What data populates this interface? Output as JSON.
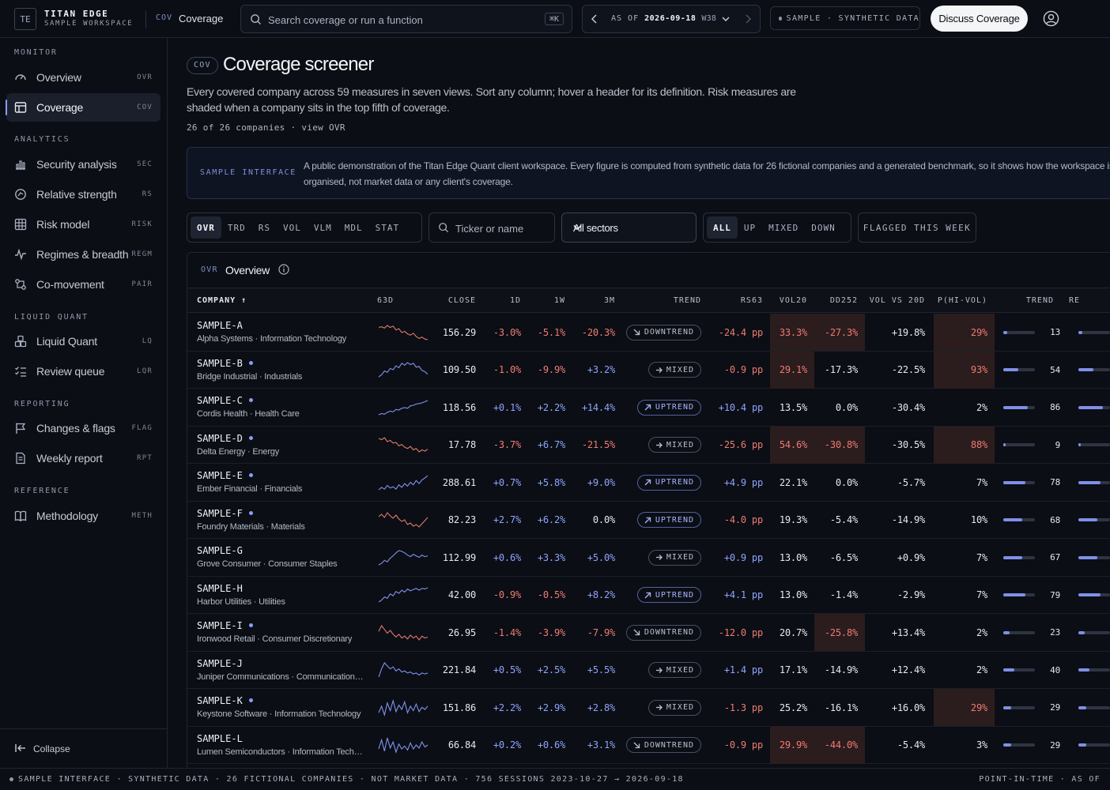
{
  "brand": {
    "logo": "TE",
    "name": "TITAN EDGE",
    "sub": "SAMPLE WORKSPACE"
  },
  "breadcrumb": {
    "code": "COV",
    "label": "Coverage"
  },
  "search": {
    "placeholder": "Search coverage or run a function",
    "shortcut": "⌘K"
  },
  "asof": {
    "label": "AS OF",
    "date": "2026-09-18",
    "week": "W38"
  },
  "sample_badge": "SAMPLE · SYNTHETIC DATA",
  "discuss_label": "Discuss Coverage",
  "sidebar": {
    "sections": [
      {
        "title": "MONITOR",
        "items": [
          {
            "label": "Overview",
            "code": "OVR",
            "icon": "gauge-icon"
          },
          {
            "label": "Coverage",
            "code": "COV",
            "icon": "table-icon",
            "active": true
          }
        ]
      },
      {
        "title": "ANALYTICS",
        "items": [
          {
            "label": "Security analysis",
            "code": "SEC",
            "icon": "bar-chart-icon"
          },
          {
            "label": "Relative strength",
            "code": "RS",
            "icon": "target-icon"
          },
          {
            "label": "Risk model",
            "code": "RISK",
            "icon": "grid-icon"
          },
          {
            "label": "Regimes & breadth",
            "code": "REGM",
            "icon": "activity-icon"
          },
          {
            "label": "Co-movement",
            "code": "PAIR",
            "icon": "link-icon"
          }
        ]
      },
      {
        "title": "LIQUID QUANT",
        "items": [
          {
            "label": "Liquid Quant",
            "code": "LQ",
            "icon": "cubes-icon"
          },
          {
            "label": "Review queue",
            "code": "LQR",
            "icon": "checklist-icon"
          }
        ]
      },
      {
        "title": "REPORTING",
        "items": [
          {
            "label": "Changes & flags",
            "code": "FLAG",
            "icon": "flag-icon"
          },
          {
            "label": "Weekly report",
            "code": "RPT",
            "icon": "document-icon"
          }
        ]
      },
      {
        "title": "REFERENCE",
        "items": [
          {
            "label": "Methodology",
            "code": "METH",
            "icon": "book-icon"
          }
        ]
      }
    ],
    "collapse_label": "Collapse"
  },
  "page": {
    "badge": "COV",
    "title": "Coverage screener",
    "description": "Every covered company across 59 measures in seven views. Sort any column; hover a header for its definition. Risk measures are shaded when a company sits in the top fifth of coverage.",
    "meta": "26 of 26 companies · view OVR"
  },
  "notice": {
    "tag": "SAMPLE INTERFACE",
    "text": "A public demonstration of the Titan Edge Quant client workspace. Every figure is computed from synthetic data for 26 fictional companies and a generated benchmark, so it shows how the workspace is organised, not market data or any client's coverage."
  },
  "view_tabs": [
    "OVR",
    "TRD",
    "RS",
    "VOL",
    "VLM",
    "MDL",
    "STAT"
  ],
  "active_view": "OVR",
  "ticker_filter": {
    "placeholder": "Ticker or name"
  },
  "sector_filter": {
    "selected": "All sectors"
  },
  "trend_filters": [
    "ALL",
    "UP",
    "MIXED",
    "DOWN"
  ],
  "active_trend": "ALL",
  "flagged_label": "FLAGGED THIS WEEK",
  "table": {
    "code": "OVR",
    "title": "Overview",
    "headers": {
      "company": "COMPANY",
      "spark": "63D",
      "close": "CLOSE",
      "d1": "1D",
      "w1": "1W",
      "m3": "3M",
      "trend": "TREND",
      "rs63": "RS63",
      "vol20": "VOL20",
      "dd252": "DD252",
      "volvs": "VOL VS 20D",
      "phivol": "P(HI-VOL)",
      "trendscore": "TREND",
      "re": "RE"
    },
    "rows": [
      {
        "ticker": "SAMPLE-A",
        "flag": false,
        "name": "Alpha Systems · Information Technology",
        "close": "156.29",
        "d1": "-3.0%",
        "w1": "-5.1%",
        "m3": "-20.3%",
        "trend": "DOWNTREND",
        "rs63": "-24.4 pp",
        "vol20": "33.3%",
        "vol20_hl": true,
        "dd252": "-27.3%",
        "dd252_hl": true,
        "volvs": "+19.8%",
        "phivol": "29%",
        "phivol_hl": true,
        "trendscore": "13",
        "spark": [
          5,
          5.2,
          4.8,
          5.6,
          5,
          5.4,
          4.2,
          4.6,
          3.4,
          3.8,
          3,
          2.6,
          3.2,
          2.2,
          1.6,
          2,
          1.4,
          1.2
        ]
      },
      {
        "ticker": "SAMPLE-B",
        "flag": true,
        "name": "Bridge Industrial · Industrials",
        "close": "109.50",
        "d1": "-1.0%",
        "w1": "-9.9%",
        "m3": "+3.2%",
        "trend": "MIXED",
        "rs63": "-0.9 pp",
        "vol20": "29.1%",
        "vol20_hl": true,
        "dd252": "-17.3%",
        "dd252_hl": false,
        "volvs": "-22.5%",
        "phivol": "93%",
        "phivol_hl": true,
        "trendscore": "54",
        "spark": [
          1.6,
          2.2,
          3.4,
          3,
          4.2,
          3.8,
          5,
          4.4,
          5.8,
          5.2,
          6,
          5.4,
          5.8,
          4.6,
          4.8,
          3.6,
          3.2,
          2.4
        ]
      },
      {
        "ticker": "SAMPLE-C",
        "flag": true,
        "name": "Cordis Health · Health Care",
        "close": "118.56",
        "d1": "+0.1%",
        "w1": "+2.2%",
        "m3": "+14.4%",
        "trend": "UPTREND",
        "rs63": "+10.4 pp",
        "vol20": "13.5%",
        "vol20_hl": false,
        "dd252": "0.0%",
        "dd252_hl": false,
        "volvs": "-30.4%",
        "phivol": "2%",
        "phivol_hl": false,
        "trendscore": "86",
        "spark": [
          1.2,
          1.6,
          1.4,
          2,
          2.4,
          2.2,
          3,
          2.8,
          3.4,
          3.6,
          3.4,
          4.2,
          4.4,
          4.8,
          5,
          5.2,
          5.6,
          6
        ]
      },
      {
        "ticker": "SAMPLE-D",
        "flag": true,
        "name": "Delta Energy · Energy",
        "close": "17.78",
        "d1": "-3.7%",
        "w1": "+6.7%",
        "m3": "-21.5%",
        "trend": "MIXED",
        "rs63": "-25.6 pp",
        "vol20": "54.6%",
        "vol20_hl": true,
        "dd252": "-30.8%",
        "dd252_hl": true,
        "volvs": "-30.5%",
        "phivol": "88%",
        "phivol_hl": true,
        "trendscore": "9",
        "spark": [
          5.6,
          5.2,
          5.8,
          4.6,
          5,
          4.2,
          4.4,
          3.4,
          3.8,
          3,
          2.6,
          3.2,
          2.2,
          2.6,
          1.6,
          2.2,
          1.8,
          2.4
        ]
      },
      {
        "ticker": "SAMPLE-E",
        "flag": true,
        "name": "Ember Financial · Financials",
        "close": "288.61",
        "d1": "+0.7%",
        "w1": "+5.8%",
        "m3": "+9.0%",
        "trend": "UPTREND",
        "rs63": "+4.9 pp",
        "vol20": "22.1%",
        "vol20_hl": false,
        "dd252": "0.0%",
        "dd252_hl": false,
        "volvs": "-5.7%",
        "phivol": "7%",
        "phivol_hl": false,
        "trendscore": "78",
        "spark": [
          1.6,
          2.4,
          1.8,
          3,
          2.2,
          2.6,
          1.8,
          3.2,
          2.4,
          3.6,
          2.8,
          4,
          3.2,
          4.6,
          3.6,
          4.8,
          5.4,
          6.2
        ]
      },
      {
        "ticker": "SAMPLE-F",
        "flag": true,
        "name": "Foundry Materials · Materials",
        "close": "82.23",
        "d1": "+2.7%",
        "w1": "+6.2%",
        "m3": "0.0%",
        "trend": "UPTREND",
        "rs63": "-4.0 pp",
        "vol20": "19.3%",
        "vol20_hl": false,
        "dd252": "-5.4%",
        "dd252_hl": false,
        "volvs": "-14.9%",
        "phivol": "10%",
        "phivol_hl": false,
        "trendscore": "68",
        "spark": [
          4.4,
          5,
          4.2,
          5.4,
          4.6,
          4,
          4.8,
          3.8,
          3.2,
          3.6,
          2.4,
          2.8,
          2,
          2.4,
          1.8,
          2.6,
          3.4,
          4.2
        ]
      },
      {
        "ticker": "SAMPLE-G",
        "flag": false,
        "name": "Grove Consumer · Consumer Staples",
        "close": "112.99",
        "d1": "+0.6%",
        "w1": "+3.3%",
        "m3": "+5.0%",
        "trend": "MIXED",
        "rs63": "+0.9 pp",
        "vol20": "13.0%",
        "vol20_hl": false,
        "dd252": "-6.5%",
        "dd252_hl": false,
        "volvs": "+0.9%",
        "phivol": "7%",
        "phivol_hl": false,
        "trendscore": "67",
        "spark": [
          1.4,
          1.8,
          2.6,
          2.2,
          3.2,
          3.8,
          4.6,
          5.2,
          5,
          4.6,
          4,
          3.6,
          4.2,
          3.8,
          3.4,
          4,
          3.6,
          3.8
        ]
      },
      {
        "ticker": "SAMPLE-H",
        "flag": false,
        "name": "Harbor Utilities · Utilities",
        "close": "42.00",
        "d1": "-0.9%",
        "w1": "-0.5%",
        "m3": "+8.2%",
        "trend": "UPTREND",
        "rs63": "+4.1 pp",
        "vol20": "13.0%",
        "vol20_hl": false,
        "dd252": "-1.4%",
        "dd252_hl": false,
        "volvs": "-2.9%",
        "phivol": "7%",
        "phivol_hl": false,
        "trendscore": "79",
        "spark": [
          1.4,
          2,
          3,
          2.6,
          4,
          3.4,
          4.8,
          4.2,
          5.2,
          4.6,
          5.6,
          5,
          5.4,
          5.8,
          5.2,
          5.8,
          5.6,
          6
        ]
      },
      {
        "ticker": "SAMPLE-I",
        "flag": true,
        "name": "Ironwood Retail · Consumer Discretionary",
        "close": "26.95",
        "d1": "-1.4%",
        "w1": "-3.9%",
        "m3": "-7.9%",
        "trend": "DOWNTREND",
        "rs63": "-12.0 pp",
        "vol20": "20.7%",
        "vol20_hl": false,
        "dd252": "-25.8%",
        "dd252_hl": true,
        "volvs": "+13.4%",
        "phivol": "2%",
        "phivol_hl": false,
        "trendscore": "23",
        "spark": [
          4.2,
          5.4,
          4.6,
          3.8,
          4.4,
          3.6,
          3,
          3.6,
          2.8,
          3.2,
          2.6,
          3.4,
          2.8,
          3.2,
          2.4,
          3.2,
          2.8,
          3
        ]
      },
      {
        "ticker": "SAMPLE-J",
        "flag": false,
        "name": "Juniper Communications · Communication Services",
        "close": "221.84",
        "d1": "+0.5%",
        "w1": "+2.5%",
        "m3": "+5.5%",
        "trend": "MIXED",
        "rs63": "+1.4 pp",
        "vol20": "17.1%",
        "vol20_hl": false,
        "dd252": "-14.9%",
        "dd252_hl": false,
        "volvs": "+12.4%",
        "phivol": "2%",
        "phivol_hl": false,
        "trendscore": "40",
        "spark": [
          2.6,
          4.2,
          5.4,
          4.8,
          4.2,
          4.6,
          3.8,
          4.2,
          3.6,
          3.8,
          3.4,
          3.6,
          3.2,
          3.4,
          3,
          3.4,
          3.2,
          3.4
        ]
      },
      {
        "ticker": "SAMPLE-K",
        "flag": true,
        "name": "Keystone Software · Information Technology",
        "close": "151.86",
        "d1": "+2.2%",
        "w1": "+2.9%",
        "m3": "+2.8%",
        "trend": "MIXED",
        "rs63": "-1.3 pp",
        "vol20": "25.2%",
        "vol20_hl": false,
        "dd252": "-16.1%",
        "dd252_hl": false,
        "volvs": "+16.0%",
        "phivol": "29%",
        "phivol_hl": true,
        "trendscore": "29",
        "spark": [
          2.6,
          3.8,
          2.2,
          4.4,
          3,
          4.8,
          2.8,
          4,
          3.2,
          4.6,
          2.6,
          3.8,
          3,
          4.2,
          2.8,
          3.6,
          3.2,
          3.8
        ]
      },
      {
        "ticker": "SAMPLE-L",
        "flag": false,
        "name": "Lumen Semiconductors · Information Technology",
        "close": "66.84",
        "d1": "+0.2%",
        "w1": "+0.6%",
        "m3": "+3.1%",
        "trend": "DOWNTREND",
        "rs63": "-0.9 pp",
        "vol20": "29.9%",
        "vol20_hl": true,
        "dd252": "-44.0%",
        "dd252_hl": true,
        "volvs": "-5.4%",
        "phivol": "3%",
        "phivol_hl": false,
        "trendscore": "29",
        "spark": [
          3,
          4.8,
          2.6,
          5.2,
          3.2,
          4.4,
          2.4,
          4,
          3,
          3.6,
          2.8,
          4.2,
          3,
          3.8,
          3.2,
          4.4,
          3.4,
          3.8
        ]
      }
    ]
  },
  "footer": {
    "left": "SAMPLE INTERFACE · SYNTHETIC DATA · 26 FICTIONAL COMPANIES · NOT MARKET DATA · 756 SESSIONS 2023-10-27 → 2026-09-18",
    "right": "POINT-IN-TIME · AS OF"
  },
  "colors": {
    "accent": "#8b9cff",
    "negative": "#ef7b72",
    "highlight": "#2b1c1d",
    "background": "#0b0e14"
  }
}
